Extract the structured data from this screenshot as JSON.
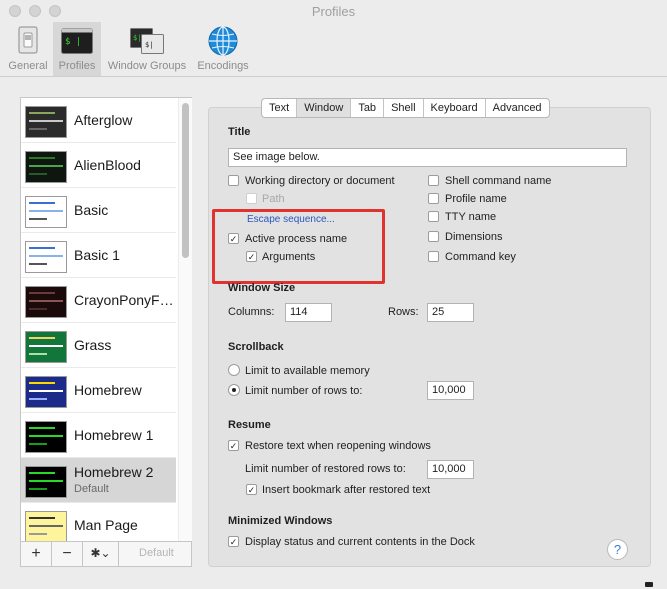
{
  "window": {
    "title": "Profiles"
  },
  "toolbar": {
    "items": [
      {
        "label": "General",
        "icon": "switch-icon"
      },
      {
        "label": "Profiles",
        "icon": "terminal-icon"
      },
      {
        "label": "Window Groups",
        "icon": "window-groups-icon"
      },
      {
        "label": "Encodings",
        "icon": "globe-icon"
      }
    ],
    "terminal_prompt": "$ |",
    "groups_prompt_back": "$|",
    "groups_prompt_front": "$|"
  },
  "profiles": {
    "items": [
      {
        "name": "Afterglow",
        "bg": "#2b2b2b",
        "bars": [
          "#8aa65b",
          "#c9c9c9",
          "#666666"
        ]
      },
      {
        "name": "AlienBlood",
        "bg": "#0f1610",
        "bars": [
          "#2a7a2a",
          "#4aa54a",
          "#2a5a2a"
        ]
      },
      {
        "name": "Basic",
        "bg": "#ffffff",
        "bars": [
          "#3a6fd3",
          "#8ab0ee",
          "#555555"
        ]
      },
      {
        "name": "Basic 1",
        "bg": "#ffffff",
        "bars": [
          "#3a6fd3",
          "#8ab0ee",
          "#555555"
        ]
      },
      {
        "name": "CrayonPonyFish",
        "bg": "#1a0a0a",
        "bars": [
          "#6b3a3a",
          "#8a5555",
          "#4a2a2a"
        ]
      },
      {
        "name": "Grass",
        "bg": "#12763b",
        "bars": [
          "#f0d36a",
          "#ffffff",
          "#a8e0a8"
        ]
      },
      {
        "name": "Homebrew",
        "bg": "#1c2a8a",
        "bars": [
          "#ffd700",
          "#ffffff",
          "#9ab0ff"
        ]
      },
      {
        "name": "Homebrew 1",
        "bg": "#000000",
        "bars": [
          "#28d928",
          "#28d928",
          "#1a9a1a"
        ]
      },
      {
        "name": "Homebrew 2",
        "sub": "Default",
        "bg": "#000000",
        "bars": [
          "#28d928",
          "#28d928",
          "#1a9a1a"
        ]
      },
      {
        "name": "Man Page",
        "bg": "#fef49c",
        "bars": [
          "#333333",
          "#666666",
          "#999999"
        ]
      }
    ],
    "add_label": "+",
    "remove_label": "−",
    "action_label": "✱⌄",
    "default_label": "Default"
  },
  "tabs": [
    "Text",
    "Window",
    "Tab",
    "Shell",
    "Keyboard",
    "Advanced"
  ],
  "title_section": {
    "heading": "Title",
    "title_value": "See image below.",
    "left_options": {
      "working_dir": "Working directory or document",
      "path": "Path",
      "escape_link": "Escape sequence...",
      "active_process": "Active process name",
      "arguments": "Arguments"
    },
    "right_options": {
      "shell_command": "Shell command name",
      "profile_name": "Profile name",
      "tty_name": "TTY name",
      "dimensions": "Dimensions",
      "command_key": "Command key"
    }
  },
  "window_size": {
    "heading": "Window Size",
    "columns_label": "Columns:",
    "columns_value": "114",
    "rows_label": "Rows:",
    "rows_value": "25"
  },
  "scrollback": {
    "heading": "Scrollback",
    "option_available": "Limit to available memory",
    "option_limit": "Limit number of rows to:",
    "limit_value": "10,000"
  },
  "resume": {
    "heading": "Resume",
    "restore_text": "Restore text when reopening windows",
    "limit_restored_label": "Limit number of restored rows to:",
    "limit_restored_value": "10,000",
    "insert_bookmark": "Insert bookmark after restored text"
  },
  "minimized": {
    "heading": "Minimized Windows",
    "display_status": "Display status and current contents in the Dock"
  },
  "help": {
    "label": "?"
  },
  "checkbox_mark": "✓"
}
